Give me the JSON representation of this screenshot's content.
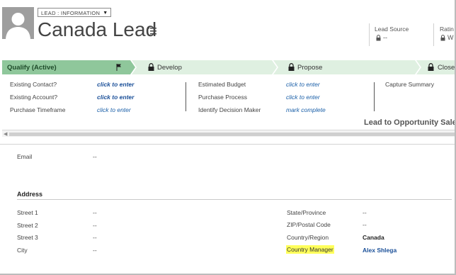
{
  "header": {
    "form_selector": "LEAD : INFORMATION",
    "title": "Canada Lead",
    "fields": [
      {
        "label": "Lead Source",
        "value": "--"
      },
      {
        "label": "Ratin",
        "value": "W"
      }
    ]
  },
  "process": {
    "stages": [
      {
        "label": "Qualify (Active)",
        "state": "active"
      },
      {
        "label": "Develop",
        "state": "pending"
      },
      {
        "label": "Propose",
        "state": "pending"
      },
      {
        "label": "Close",
        "state": "pending"
      }
    ],
    "steps": {
      "col1": [
        {
          "label": "Existing Contact?",
          "value": "click to enter"
        },
        {
          "label": "Existing Account?",
          "value": "click to enter"
        },
        {
          "label": "Purchase Timeframe",
          "value": "click to enter"
        }
      ],
      "col2": [
        {
          "label": "Estimated Budget",
          "value": "click to enter"
        },
        {
          "label": "Purchase Process",
          "value": "click to enter"
        },
        {
          "label": "Identify Decision Maker",
          "value": "mark complete"
        }
      ],
      "col3": [
        {
          "label": "Capture Summary"
        }
      ]
    },
    "name": "Lead to Opportunity Sale"
  },
  "form": {
    "email": {
      "label": "Email",
      "value": "--"
    },
    "address": {
      "title": "Address",
      "left": [
        {
          "label": "Street 1",
          "value": "--"
        },
        {
          "label": "Street 2",
          "value": "--"
        },
        {
          "label": "Street 3",
          "value": "--"
        },
        {
          "label": "City",
          "value": "--"
        }
      ],
      "right": [
        {
          "label": "State/Province",
          "value": "--"
        },
        {
          "label": "ZIP/Postal Code",
          "value": "--"
        },
        {
          "label": "Country/Region",
          "value": "Canada"
        },
        {
          "label": "Country Manager",
          "value": "Alex Shlega"
        }
      ]
    }
  },
  "colors": {
    "active_stage": "#8fc79b",
    "pending_stage": "#dff0e1",
    "link": "#1a5fa8",
    "highlight": "#ffff5a"
  },
  "icons": {
    "avatar": "person-silhouette",
    "menu": "list-menu-icon",
    "flag": "flag-icon",
    "lock": "lock-icon"
  }
}
